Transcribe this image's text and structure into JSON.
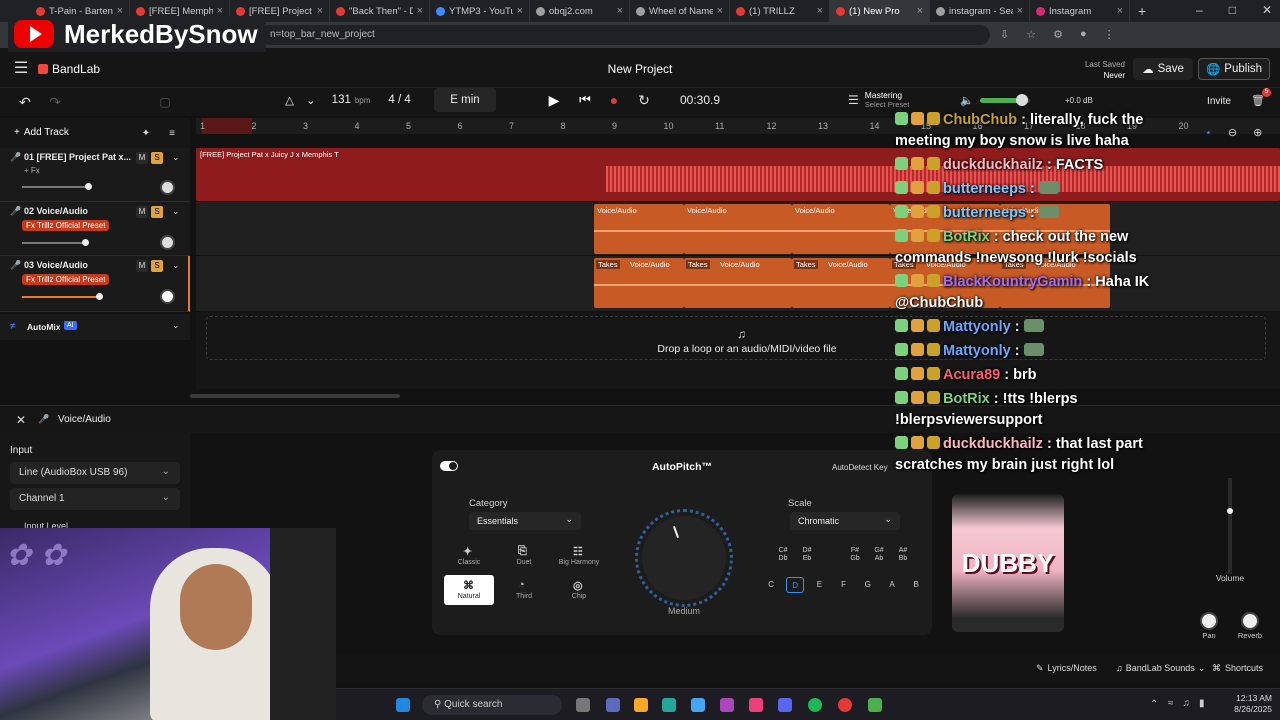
{
  "browser": {
    "tabs": [
      {
        "label": "T-Pain - Bartende",
        "color": "#e53935"
      },
      {
        "label": "[FREE] Memphis",
        "color": "#e53935"
      },
      {
        "label": "[FREE] Project Pa",
        "color": "#e53935"
      },
      {
        "label": "\"Back Then\" - Du",
        "color": "#e53935"
      },
      {
        "label": "YTMP3 - YouTube",
        "color": "#3d8bfd"
      },
      {
        "label": "obqj2.com",
        "color": "#9e9e9e"
      },
      {
        "label": "Wheel of Names",
        "color": "#9e9e9e"
      },
      {
        "label": "(1) TRILLZ",
        "color": "#e53935"
      },
      {
        "label": "(1) New Pro",
        "color": "#e53935",
        "active": true
      },
      {
        "label": "instagram - Sear",
        "color": "#9e9e9e"
      },
      {
        "label": "Instagram",
        "color": "#d62976"
      }
    ],
    "new_tab": "+",
    "url": "n=top_bar_new_project"
  },
  "stream_brand": "MerkedBySnow",
  "app": {
    "logo": "BandLab",
    "project_title": "New Project",
    "last_saved_label": "Last Saved",
    "last_saved_value": "Never",
    "save": "Save",
    "publish": "Publish",
    "invite": "Invite",
    "notif_count": "5"
  },
  "toolbar": {
    "bpm": "131",
    "bpm_unit": "bpm",
    "time_sig": "4 / 4",
    "key": "E min",
    "time": "00:30.9",
    "mastering": "Mastering",
    "select_preset": "Select Preset",
    "gain": "+0.0 dB",
    "add_track": "Add Track"
  },
  "ruler": [
    "1",
    "2",
    "3",
    "4",
    "5",
    "6",
    "7",
    "8",
    "9",
    "10",
    "11",
    "12",
    "13",
    "14",
    "15",
    "16",
    "17",
    "18",
    "19",
    "20"
  ],
  "tracks": [
    {
      "name": "01 [FREE] Project Pat x...",
      "fx": "+ Fx",
      "clip": "[FREE] Project Pat x Juicy J x Memphis T"
    },
    {
      "name": "02 Voice/Audio",
      "fx": "Fx Trillz Official Preset",
      "clip": "Voice/Audio"
    },
    {
      "name": "03 Voice/Audio",
      "fx": "Fx Trillz Official Preset",
      "clip": "Voice/Audio",
      "takes": "Takes"
    }
  ],
  "automix": {
    "label": "AutoMix",
    "badge": "AI"
  },
  "dropzone": "Drop a loop or an audio/MIDI/video file",
  "chat": [
    {
      "user": "ChubChub",
      "color": "#c9a227",
      "msg": "literally, fuck the meeting my boy snow is live haha"
    },
    {
      "user": "duckduckhailz",
      "color": "#ffb6c1",
      "msg": "FACTS"
    },
    {
      "user": "butterneeps",
      "color": "#79c7ff",
      "msg": ""
    },
    {
      "user": "butterneeps",
      "color": "#79c7ff",
      "msg": ""
    },
    {
      "user": "BotRix",
      "color": "#7cd17c",
      "msg": "check out the new commands !newsong !lurk !socials"
    },
    {
      "user": "BlackKountryGamin",
      "color": "#a56cf0",
      "msg": "Haha IK @ChubChub"
    },
    {
      "user": "Mattyonly",
      "color": "#6aa8ff",
      "msg": ""
    },
    {
      "user": "Mattyonly",
      "color": "#6aa8ff",
      "msg": ""
    },
    {
      "user": "Acura89",
      "color": "#ff5d73",
      "msg": "brb"
    },
    {
      "user": "BotRix",
      "color": "#7cd17c",
      "msg": "!tts !blerps !blerpsviewersupport"
    },
    {
      "user": "duckduckhailz",
      "color": "#ffb6c1",
      "msg": "that last part scratches my brain just right lol"
    }
  ],
  "panel": {
    "title": "Voice/Audio",
    "input_label": "Input",
    "input_device": "Line (AudioBox USB 96)",
    "channel": "Channel 1",
    "input_level": "Input Level"
  },
  "autopitch": {
    "title": "AutoPitch™",
    "autodetect": "AutoDetect Key",
    "category_label": "Category",
    "category": "Essentials",
    "scale_label": "Scale",
    "scale": "Chromatic",
    "knob_label": "Medium",
    "algorithms": [
      "Classic",
      "Duet",
      "Big Harmony",
      "Natural",
      "Third",
      "Chip"
    ],
    "sharps": [
      "C#\nDb",
      "D#\nEb",
      "F#\nGb",
      "G#\nAb",
      "A#\nBb"
    ],
    "naturals": [
      "C",
      "D",
      "E",
      "F",
      "G",
      "A",
      "B"
    ]
  },
  "mixer": {
    "volume": "Volume",
    "pan": "Pan",
    "reverb": "Reverb"
  },
  "footer": {
    "lyrics": "Lyrics/Notes",
    "sounds": "BandLab Sounds",
    "shortcuts": "Shortcuts"
  },
  "taskbar": {
    "search": "Quick search",
    "time": "12:13 AM",
    "date": "8/26/2025"
  }
}
